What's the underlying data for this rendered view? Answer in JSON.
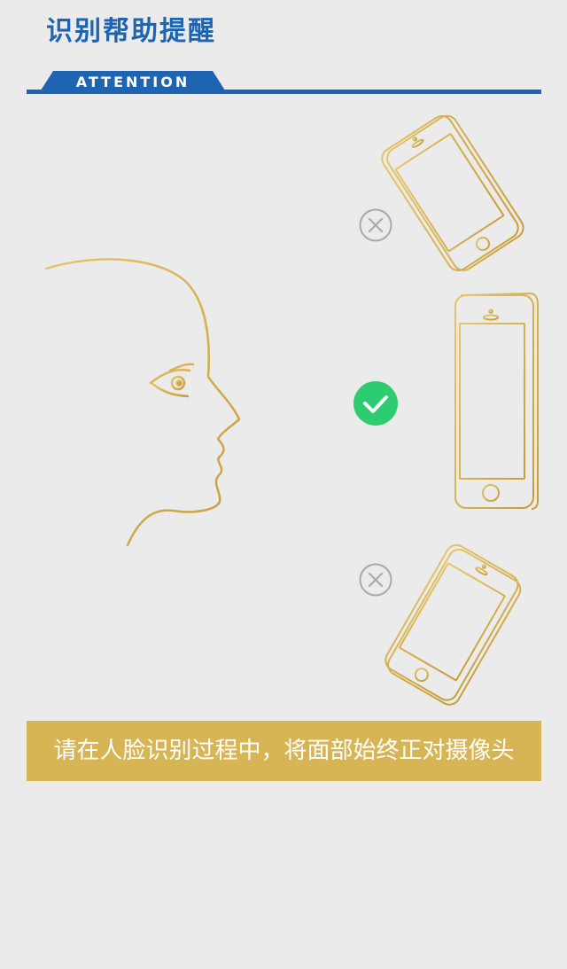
{
  "header": {
    "title": "识别帮助提醒"
  },
  "attention": {
    "label": "ATTENTION",
    "color": "#1f64b0"
  },
  "illustration": {
    "icons": {
      "tilted_back": "close-circle-icon",
      "upright": "check-circle-icon",
      "tilted_forward": "close-circle-icon"
    },
    "colors": {
      "gold": "#d2ad4a",
      "check_green": "#2ecc71",
      "cross_gray": "#a8a8a8"
    }
  },
  "caption": {
    "text": "请在人脸识别过程中，将面部始终正对摄像头",
    "background": "#d7b554"
  }
}
